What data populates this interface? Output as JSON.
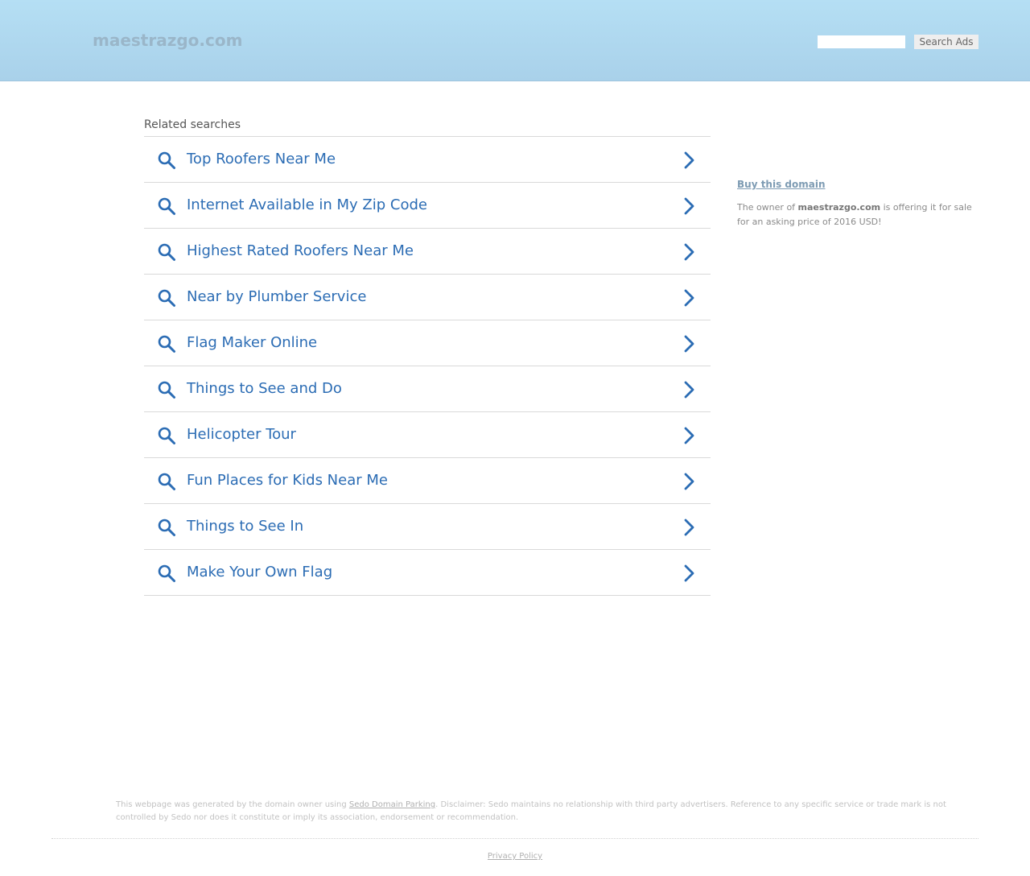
{
  "header": {
    "site_name": "maestrazgo.com",
    "search_placeholder": "",
    "search_button": "Search Ads"
  },
  "related": {
    "title": "Related searches",
    "items": [
      {
        "label": "Top Roofers Near Me"
      },
      {
        "label": "Internet Available in My Zip Code"
      },
      {
        "label": "Highest Rated Roofers Near Me"
      },
      {
        "label": "Near by Plumber Service"
      },
      {
        "label": "Flag Maker Online"
      },
      {
        "label": "Things to See and Do"
      },
      {
        "label": "Helicopter Tour"
      },
      {
        "label": "Fun Places for Kids Near Me"
      },
      {
        "label": "Things to See In"
      },
      {
        "label": "Make Your Own Flag"
      }
    ]
  },
  "sidebar": {
    "buy_link": "Buy this domain",
    "sale_prefix": "The owner of ",
    "sale_domain": "maestrazgo.com",
    "sale_suffix": " is offering it for sale for an asking price of 2016 USD!"
  },
  "footer": {
    "disclaimer_prefix": "This webpage was generated by the domain owner using ",
    "disclaimer_link": "Sedo Domain Parking",
    "disclaimer_suffix": ". Disclaimer: Sedo maintains no relationship with third party advertisers. Reference to any specific service or trade mark is not controlled by Sedo nor does it constitute or imply its association, endorsement or recommendation.",
    "privacy_policy": "Privacy Policy"
  },
  "colors": {
    "link_blue": "#2b6cb4",
    "header_top": "#b5dff4",
    "header_bottom": "#a9d1ea"
  },
  "icons": {
    "item_icon": "search-icon",
    "item_arrow": "chevron-right-icon"
  }
}
